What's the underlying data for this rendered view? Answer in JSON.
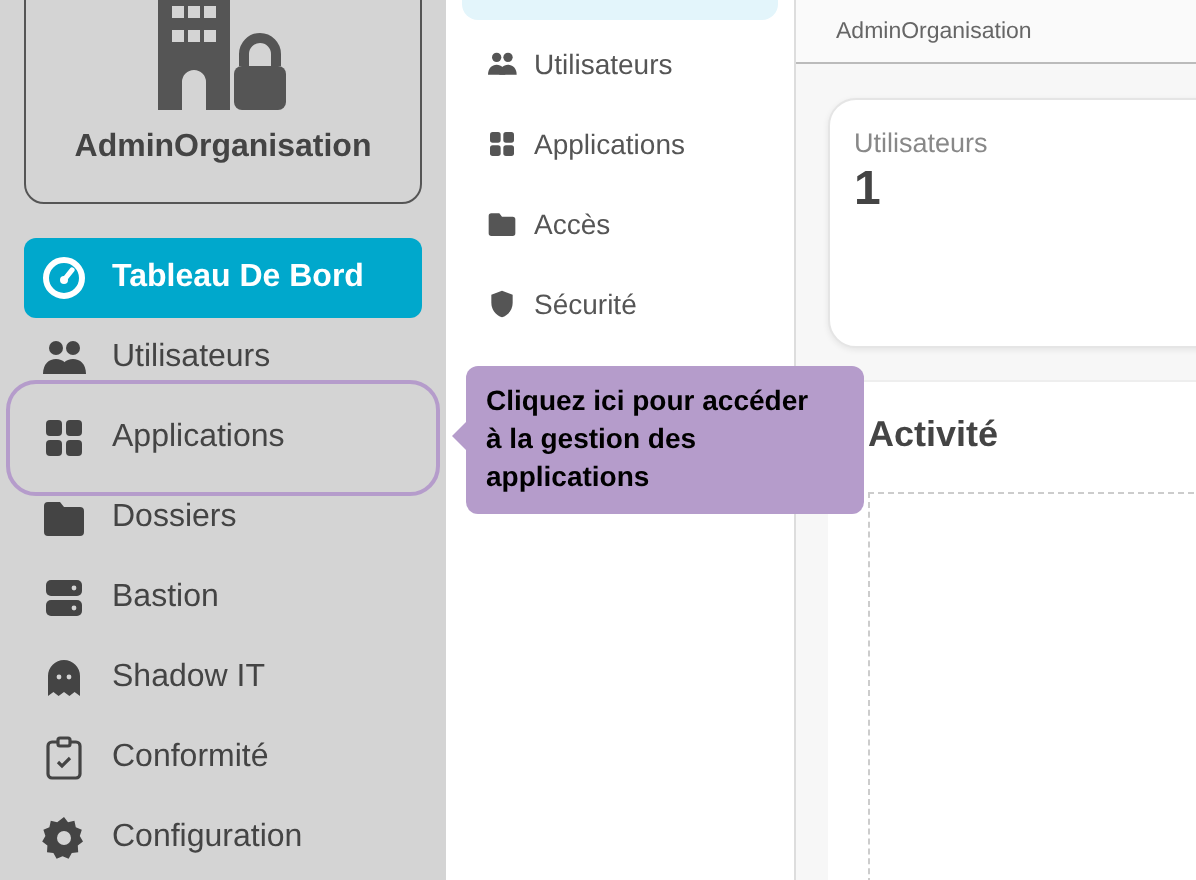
{
  "org": {
    "name": "AdminOrganisation"
  },
  "sidebar": {
    "items": [
      {
        "label": "Tableau De Bord",
        "selected": true,
        "highlighted": false
      },
      {
        "label": "Utilisateurs",
        "selected": false,
        "highlighted": false
      },
      {
        "label": "Applications",
        "selected": false,
        "highlighted": true
      },
      {
        "label": "Dossiers",
        "selected": false,
        "highlighted": false
      },
      {
        "label": "Bastion",
        "selected": false,
        "highlighted": false
      },
      {
        "label": "Shadow IT",
        "selected": false,
        "highlighted": false
      },
      {
        "label": "Conformité",
        "selected": false,
        "highlighted": false
      },
      {
        "label": "Configuration",
        "selected": false,
        "highlighted": false
      }
    ]
  },
  "subnav": {
    "items": [
      {
        "label": "Utilisateurs"
      },
      {
        "label": "Applications"
      },
      {
        "label": "Accès"
      },
      {
        "label": "Sécurité"
      }
    ]
  },
  "header": {
    "breadcrumb": "AdminOrganisation"
  },
  "stat_card": {
    "label": "Utilisateurs",
    "value": "1"
  },
  "activity": {
    "title": "Activité"
  },
  "tooltip": {
    "text": "Cliquez ici pour accéder à la gestion des applications"
  }
}
